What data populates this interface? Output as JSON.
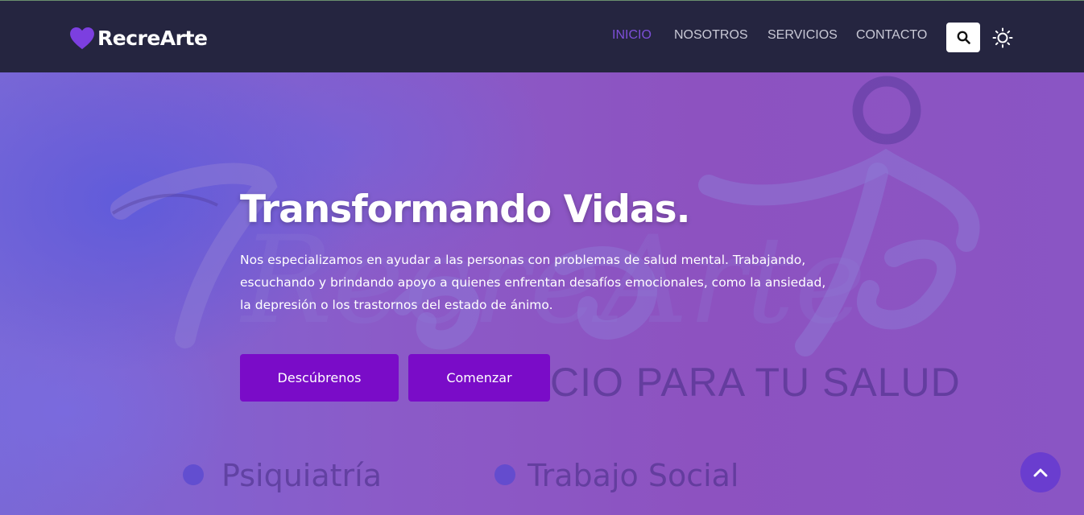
{
  "header": {
    "brand": "RecreArte",
    "nav": [
      {
        "label": "INICIO",
        "active": true
      },
      {
        "label": "NOSOTROS",
        "active": false
      },
      {
        "label": "SERVICIOS",
        "active": false
      },
      {
        "label": "CONTACTO",
        "active": false
      }
    ],
    "search_icon": "search-icon",
    "theme_icon": "sun-icon"
  },
  "hero": {
    "title": "Transformando Vidas.",
    "description_lines": [
      "Nos especializamos en ayudar a las personas con problemas de salud mental. Trabajando,",
      "escuchando y brindando apoyo a quienes enfrentan desafíos emocionales, como la ansiedad,",
      "la depresión o los trastornos del estado de ánimo."
    ],
    "buttons": {
      "discover": "Descúbrenos",
      "start": "Comenzar"
    },
    "background_text": {
      "logo": "RecreArte",
      "tagline": "CIO PARA TU SALUD",
      "service_1": "Psiquiatría",
      "service_2": "Trabajo Social"
    }
  },
  "scroll_top_icon": "chevron-up-icon",
  "colors": {
    "navbar_bg": "#252540",
    "accent": "#7d4fd8",
    "button_bg": "#7a0cc8",
    "hero_overlay": "#8a55c4"
  }
}
